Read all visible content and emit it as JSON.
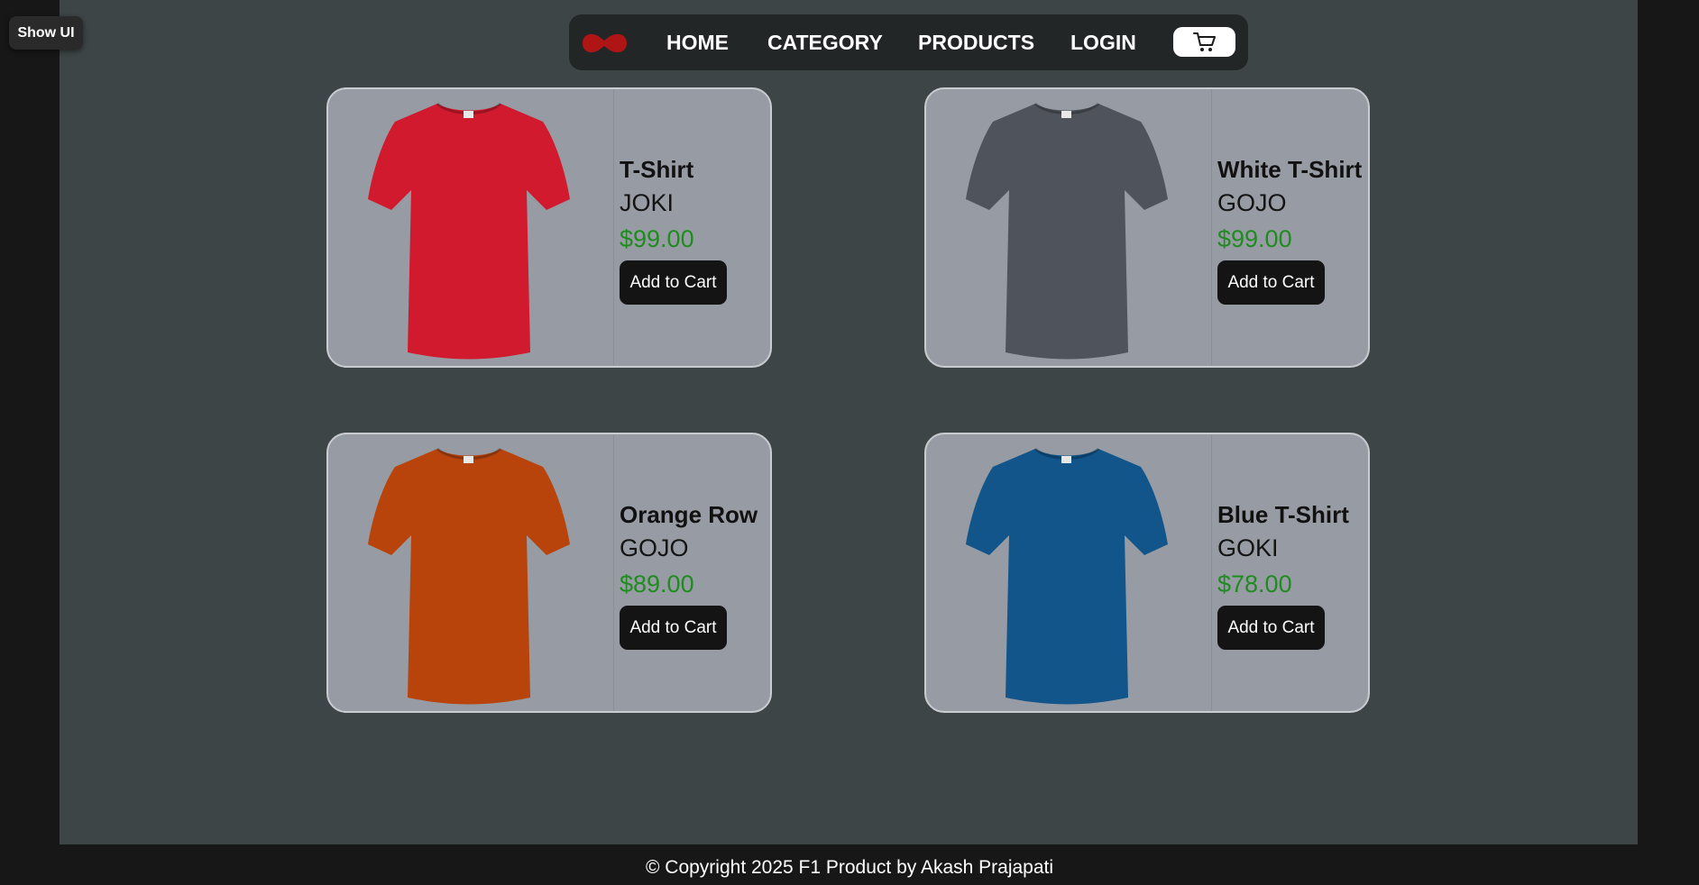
{
  "show_ui_label": "Show UI",
  "nav": {
    "links": [
      "HOME",
      "CATEGORY",
      "PRODUCTS",
      "LOGIN"
    ],
    "logo_color": "#b01515"
  },
  "products": [
    {
      "name": "T-Shirt",
      "brand": "JOKI",
      "price": "$99.00",
      "button": "Add to Cart",
      "color": "#d11a2e"
    },
    {
      "name": "White T-Shirt",
      "brand": "GOJO",
      "price": "$99.00",
      "button": "Add to Cart",
      "color": "#4f545c"
    },
    {
      "name": "Orange Row",
      "brand": "GOJO",
      "price": "$89.00",
      "button": "Add to Cart",
      "color": "#b8440c"
    },
    {
      "name": "Blue T-Shirt",
      "brand": "GOKI",
      "price": "$78.00",
      "button": "Add to Cart",
      "color": "#11558a"
    }
  ],
  "footer": "© Copyright 2025 F1 Product by Akash Prajapati",
  "colors": {
    "page_bg": "#171717",
    "main_bg": "#3e4546",
    "card_bg": "#979ba3",
    "price_green": "#1f8c1f"
  }
}
